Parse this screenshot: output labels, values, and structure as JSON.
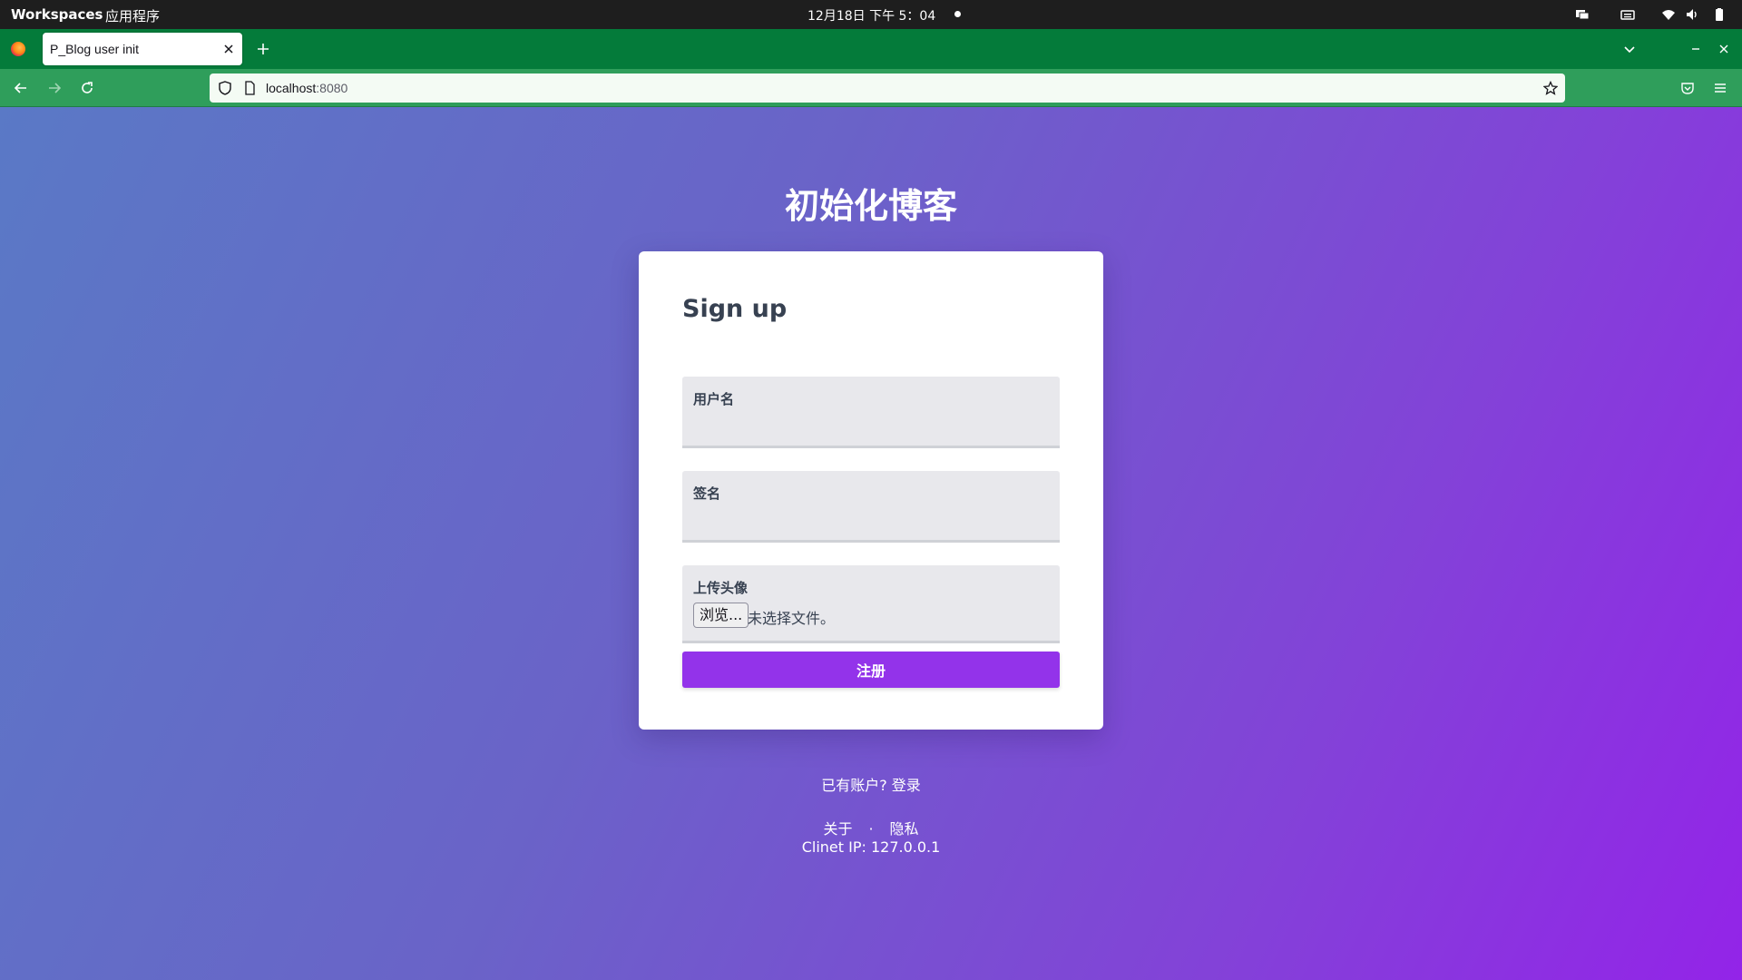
{
  "system_bar": {
    "activities": "Workspaces",
    "applications": "应用程序",
    "clock": "12月18日  下午 5：04"
  },
  "browser": {
    "tab_title": "P_Blog user init",
    "url_host": "localhost",
    "url_port": ":8080",
    "accent_color": "#047b3a"
  },
  "page": {
    "title": "初始化博客",
    "form": {
      "heading": "Sign up",
      "username_label": "用户名",
      "signature_label": "签名",
      "avatar_label": "上传头像",
      "browse_button": "浏览...",
      "file_status": "未选择文件。",
      "submit_label": "注册"
    },
    "login_prompt": "已有账户? 登录",
    "footer": {
      "about": "关于",
      "separator": "·",
      "privacy": "隐私",
      "client_ip": "Clinet IP: 127.0.0.1"
    },
    "button_color": "#9333ea"
  }
}
